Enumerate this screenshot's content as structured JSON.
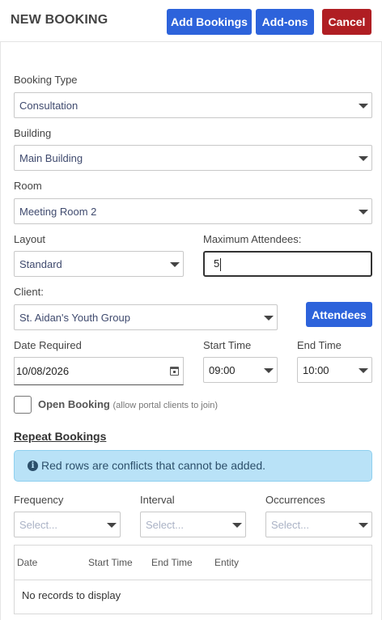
{
  "header": {
    "title": "NEW BOOKING",
    "add_bookings_label": "Add Bookings",
    "addons_label": "Add-ons",
    "cancel_label": "Cancel"
  },
  "form": {
    "booking_type": {
      "label": "Booking Type",
      "value": "Consultation"
    },
    "building": {
      "label": "Building",
      "value": "Main Building"
    },
    "room": {
      "label": "Room",
      "value": "Meeting Room 2"
    },
    "layout": {
      "label": "Layout",
      "value": "Standard"
    },
    "max_attendees": {
      "label": "Maximum Attendees:",
      "value": "5"
    },
    "client": {
      "label": "Client:",
      "value": "St. Aidan's Youth Group"
    },
    "attendees_button": "Attendees",
    "date_required": {
      "label": "Date Required",
      "value": "10/08/2026"
    },
    "start_time": {
      "label": "Start Time",
      "value": "09:00"
    },
    "end_time": {
      "label": "End Time",
      "value": "10:00"
    },
    "open_booking": {
      "label": "Open Booking",
      "note": "(allow portal clients to join)",
      "checked": false
    }
  },
  "repeat": {
    "heading": "Repeat Bookings",
    "alert": "Red rows are conflicts that cannot be added.",
    "frequency": {
      "label": "Frequency",
      "placeholder": "Select..."
    },
    "interval": {
      "label": "Interval",
      "placeholder": "Select..."
    },
    "occurrences": {
      "label": "Occurrences",
      "placeholder": "Select..."
    }
  },
  "grid": {
    "columns": [
      "Date",
      "Start Time",
      "End Time",
      "Entity"
    ],
    "empty_message": "No records to display"
  },
  "colors": {
    "primary": "#2d63db",
    "danger": "#b01e23",
    "info_bg": "#b9e2f7",
    "info_text": "#2c4f6a"
  },
  "icons": {
    "dropdown": "chevron-down-icon",
    "calendar": "calendar-icon",
    "info": "info-circle-icon"
  }
}
